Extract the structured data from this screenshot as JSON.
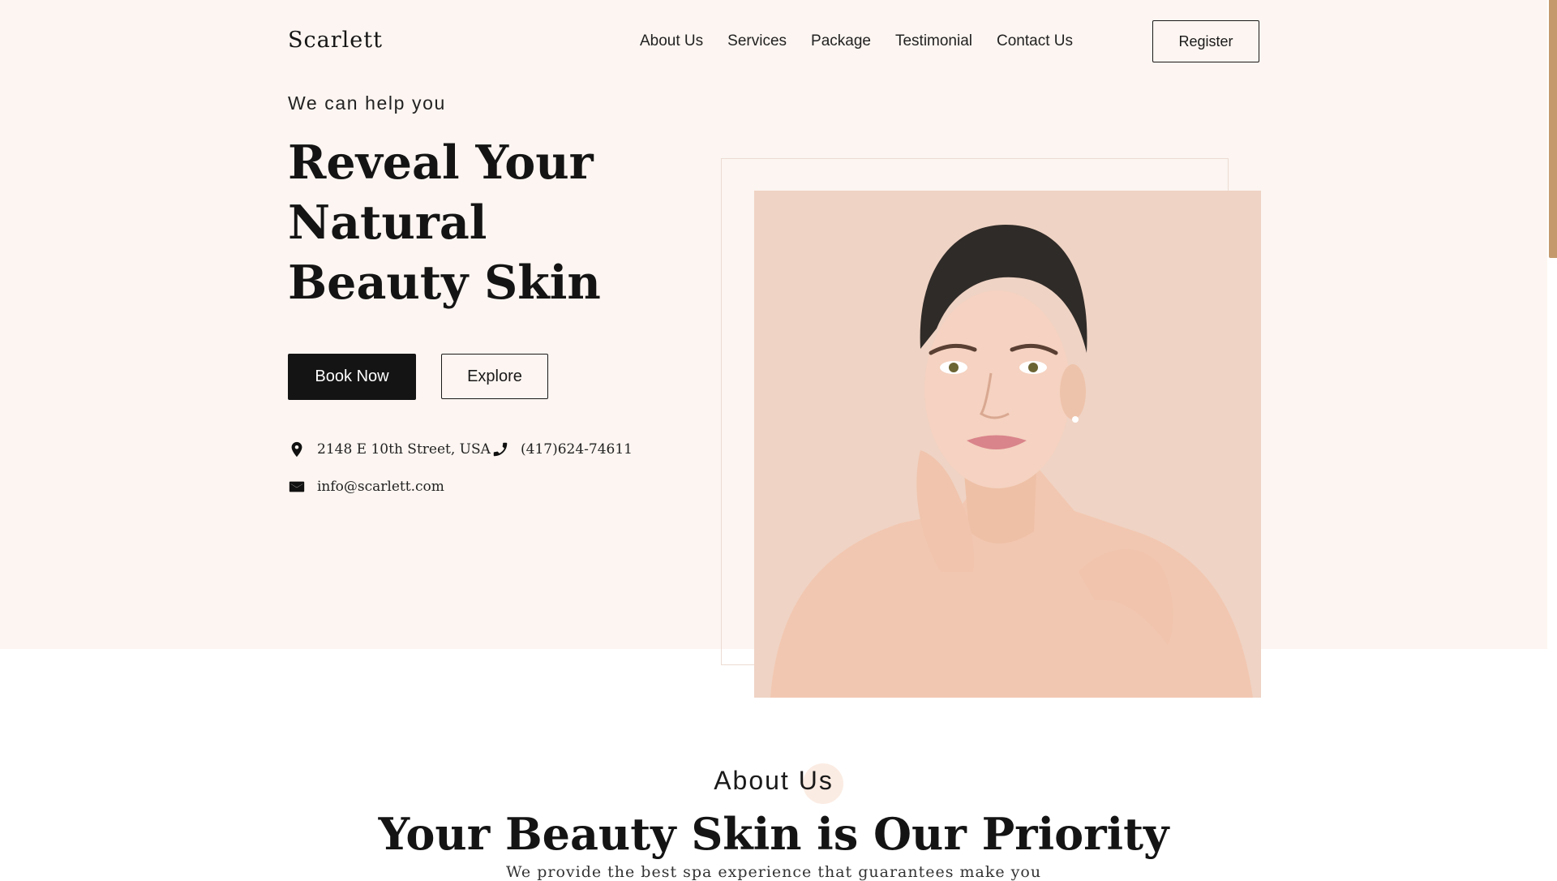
{
  "brand": {
    "name": "Scarlett"
  },
  "nav": {
    "items": [
      {
        "label": "About Us"
      },
      {
        "label": "Services"
      },
      {
        "label": "Package"
      },
      {
        "label": "Testimonial"
      },
      {
        "label": "Contact Us"
      }
    ],
    "register_label": "Register"
  },
  "hero": {
    "eyebrow": "We can help you",
    "headline_lines": [
      "Reveal Your",
      "Natural",
      "Beauty Skin"
    ],
    "book_label": "Book Now",
    "explore_label": "Explore",
    "address": "2148 E 10th Street, USA",
    "phone": "(417)624-74611",
    "email": "info@scarlett.com",
    "image_icon": "woman-portrait"
  },
  "about": {
    "eyebrow": "About Us",
    "title": "Your Beauty Skin is Our Priority",
    "subtitle": "We provide the best spa experience that guarantees make you"
  },
  "colors": {
    "hero_bg": "#fcf5f1",
    "photo_bg": "#efd3c4",
    "accent": "#c49a6c",
    "dark": "#141414"
  }
}
